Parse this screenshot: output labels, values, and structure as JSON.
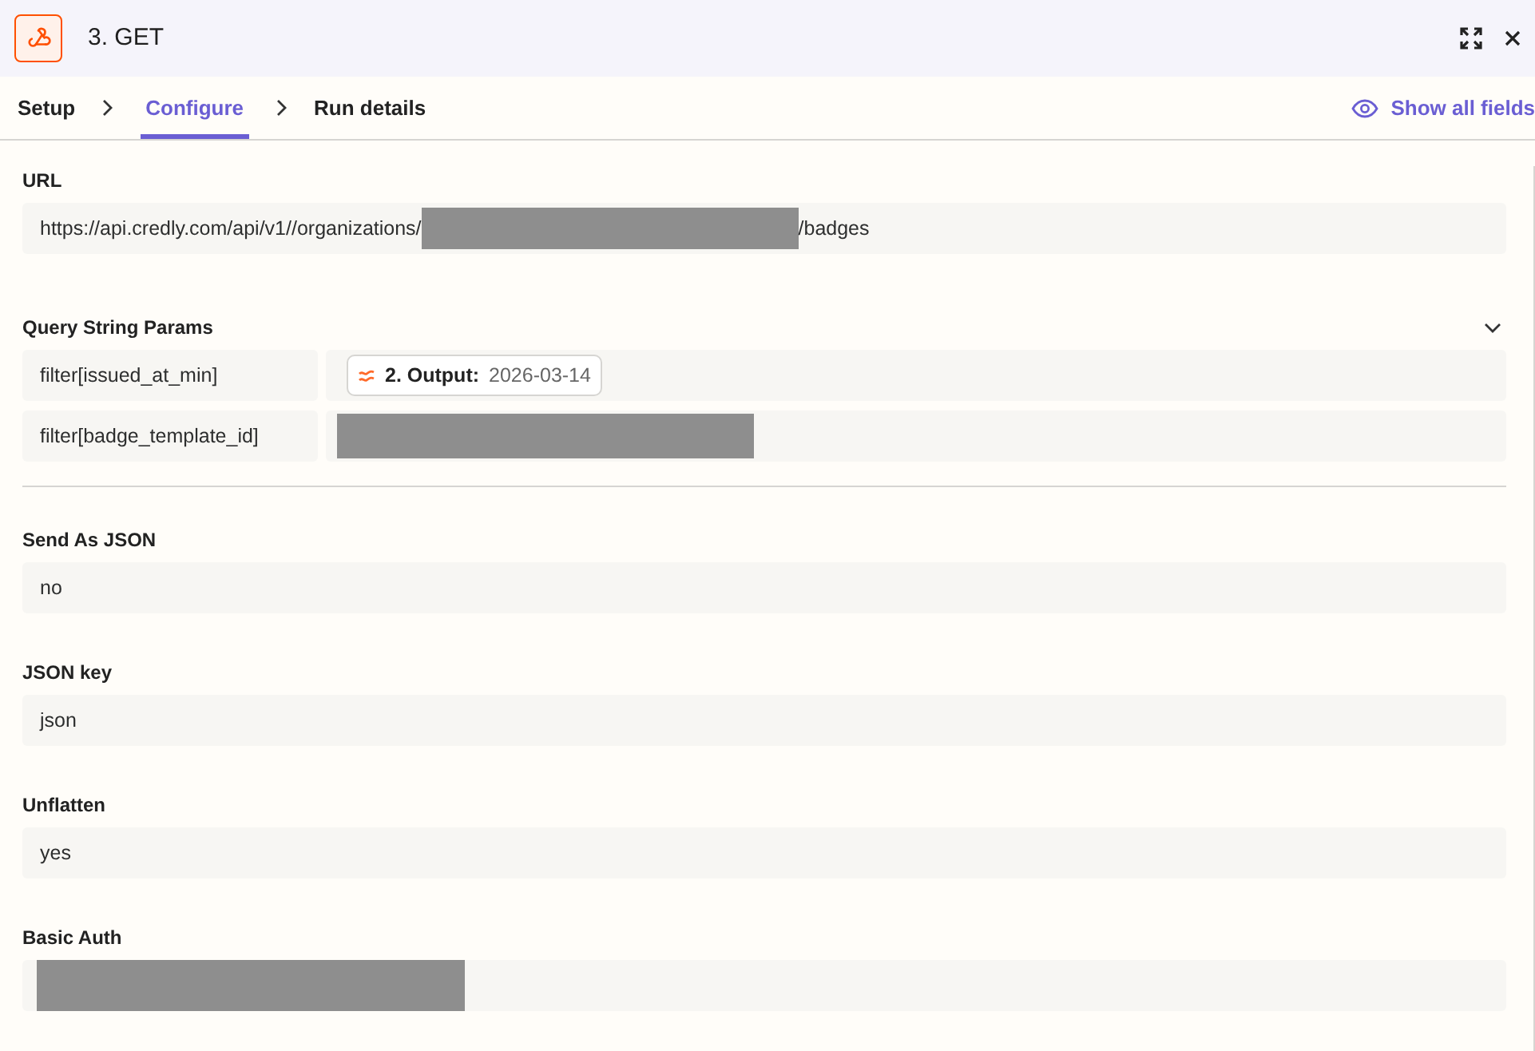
{
  "header": {
    "title": "3. GET"
  },
  "tabs": [
    {
      "label": "Setup",
      "selected": false
    },
    {
      "label": "Configure",
      "selected": true
    },
    {
      "label": "Run details",
      "selected": false
    }
  ],
  "show_all_fields": "Show all fields",
  "url": {
    "label": "URL",
    "before": "https://api.credly.com/api/v1//organizations/",
    "after": "/badges"
  },
  "query_params": {
    "label": "Query String Params",
    "expanded": true,
    "rows": [
      {
        "key": "filter[issued_at_min]",
        "kind": "token",
        "token_label": "2. Output:",
        "token_value": "2026-03-14"
      },
      {
        "key": "filter[badge_template_id]",
        "kind": "redacted"
      }
    ]
  },
  "fields": [
    {
      "label": "Send As JSON",
      "value": "no",
      "kind": "text"
    },
    {
      "label": "JSON key",
      "value": "json",
      "kind": "text"
    },
    {
      "label": "Unflatten",
      "value": "yes",
      "kind": "text"
    },
    {
      "label": "Basic Auth",
      "kind": "redacted"
    }
  ]
}
